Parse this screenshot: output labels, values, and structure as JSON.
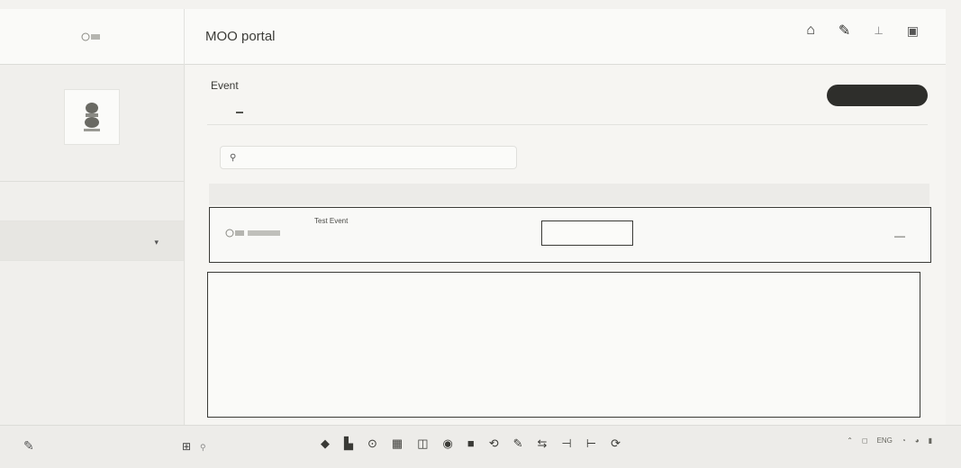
{
  "app": {
    "title": "MOO portal",
    "logo_text": "",
    "top_icons": [
      "home-icon",
      "notification-icon",
      "download-icon",
      "profile-icon"
    ]
  },
  "sidebar": {
    "profile_name": "",
    "items": [
      {
        "label": "",
        "name": "home"
      },
      {
        "label": "",
        "name": "users",
        "expanded": true
      }
    ],
    "sub_items": [
      "",
      "",
      "",
      "",
      ""
    ]
  },
  "main": {
    "page_title": "Event",
    "create_button": "",
    "tabs": [
      {
        "label": "",
        "active": false
      },
      {
        "label": "",
        "active": true
      },
      {
        "label": "",
        "active": false
      },
      {
        "label": "",
        "active": false
      },
      {
        "label": "",
        "active": false
      },
      {
        "label": "",
        "active": false
      }
    ],
    "search_placeholder": "",
    "table": {
      "columns": [
        "",
        "",
        "",
        "",
        ""
      ],
      "rows": [
        {
          "name": "Test Event",
          "date_left": "",
          "input_value": "",
          "date_right": "",
          "action": "—"
        }
      ]
    }
  },
  "taskbar": {
    "search_label": "",
    "clock_time": "",
    "clock_date": ""
  }
}
